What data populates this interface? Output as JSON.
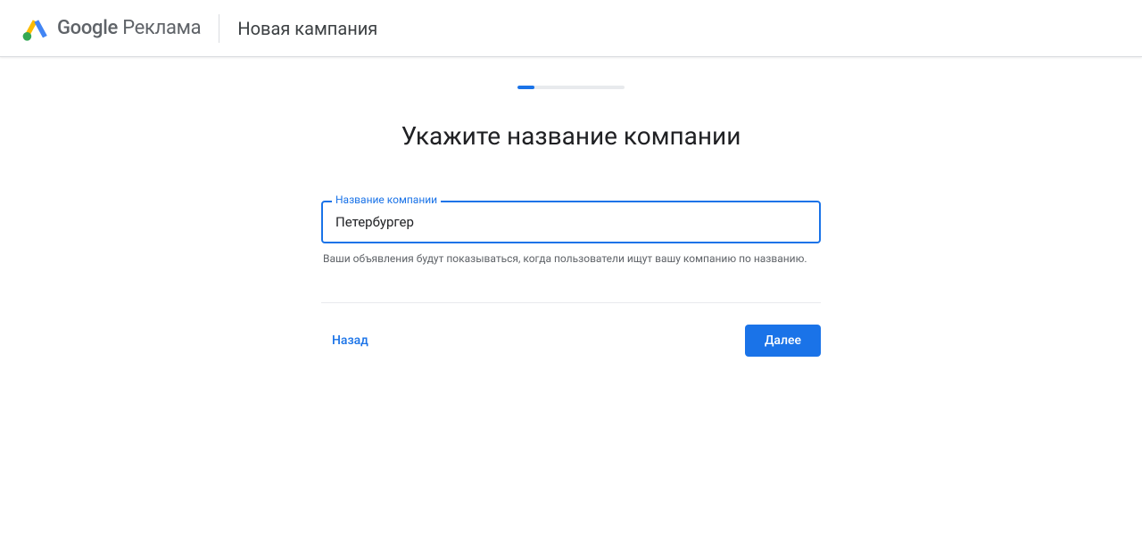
{
  "header": {
    "brand_google": "Google",
    "brand_product": "Реклама",
    "title": "Новая кампания"
  },
  "progress": {
    "percent": 16
  },
  "main": {
    "heading": "Укажите название компании",
    "company_name": {
      "label": "Название компании",
      "value": "Петербургер",
      "help": "Ваши объявления будут показываться, когда пользователи ищут вашу компанию по названию."
    }
  },
  "buttons": {
    "back": "Назад",
    "next": "Далее"
  },
  "colors": {
    "primary": "#1a73e8",
    "text_secondary": "#5f6368"
  }
}
